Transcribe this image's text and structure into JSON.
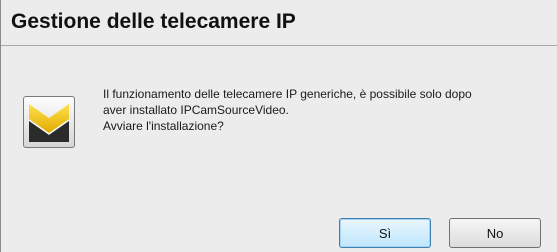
{
  "dialog": {
    "title": "Gestione delle telecamere IP",
    "message_lines": [
      "Il funzionamento delle telecamere IP generiche, è possibile solo dopo",
      "aver installato IPCamSourceVideo.",
      "Avviare l'installazione?"
    ],
    "icon": "setup-logo-icon",
    "buttons": {
      "yes_label": "Sì",
      "no_label": "No"
    },
    "colors": {
      "background": "#ececec",
      "icon_yellow": "#f5c400",
      "icon_dark": "#2b2b2b",
      "default_button_border": "#3c7fb1"
    }
  }
}
